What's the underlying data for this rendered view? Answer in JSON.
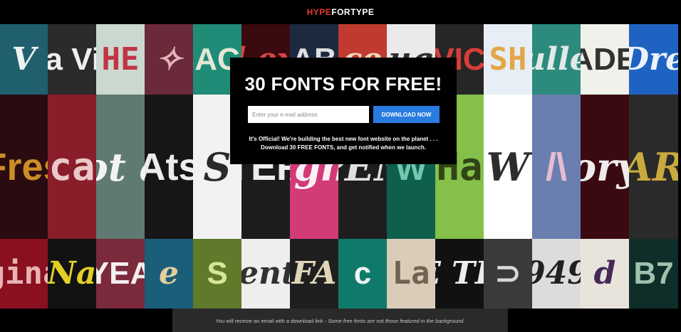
{
  "header": {
    "logo_hype": "HYPE",
    "logo_for_type": "FORTYPE"
  },
  "signup": {
    "title": "30 FONTS FOR FREE!",
    "email_placeholder": "Enter your e-mail address",
    "download_label": "DOWNLOAD NOW",
    "description_line1": "It's Official! We're building the best new font website on the planet . . .",
    "description_line2": "Download 30 FREE FONTS, and get notified when we launch."
  },
  "footer": {
    "text_normal": "You will receive an email with a download link - ",
    "text_italic": "Some free fonts are not those featured in the background."
  },
  "background_tiles": [
    {
      "text": "V",
      "bg": "#1f5f6e",
      "fg": "#ffffff"
    },
    {
      "text": "Sa Vin",
      "bg": "#2b2b2b",
      "fg": "#ffffff"
    },
    {
      "text": "HE",
      "bg": "#cbd8cf",
      "fg": "#c0283b"
    },
    {
      "text": "✧",
      "bg": "#6a2a3a",
      "fg": "#f0c0c8"
    },
    {
      "text": "BACC",
      "bg": "#1e8c76",
      "fg": "#f5efe0"
    },
    {
      "text": "al exq",
      "bg": "#3a0a0e",
      "fg": "#e54a4a"
    },
    {
      "text": "AB",
      "bg": "#1c2a40",
      "fg": "#f0f0f0"
    },
    {
      "text": "ce",
      "bg": "#c03a30",
      "fg": "#f7e7cc"
    },
    {
      "text": "ug",
      "bg": "#eaeaea",
      "fg": "#202020"
    },
    {
      "text": "VIC",
      "bg": "#262626",
      "fg": "#e8403a"
    },
    {
      "text": "SH",
      "bg": "#e8eef5",
      "fg": "#e3a13b"
    },
    {
      "text": "ulle",
      "bg": "#2c8b7d",
      "fg": "#f2f2f2"
    },
    {
      "text": "MADE T",
      "bg": "#f2f0ea",
      "fg": "#222222"
    },
    {
      "text": "Dre",
      "bg": "#1f63c2",
      "fg": "#ffffff"
    },
    {
      "text": "Fres",
      "bg": "#2a0c10",
      "fg": "#d99a2a"
    },
    {
      "text": "Scar",
      "bg": "#8a1d2a",
      "fg": "#f4d7d7"
    },
    {
      "text": "Not all",
      "bg": "#5f7a72",
      "fg": "#ffffff"
    },
    {
      "text": "Ats",
      "bg": "#161616",
      "fg": "#ffffff"
    },
    {
      "text": "S",
      "bg": "#f2f2f2",
      "fg": "#1a1a1a"
    },
    {
      "text": "TER",
      "bg": "#1c1c1c",
      "fg": "#ffffff"
    },
    {
      "text": "igh",
      "bg": "#d23a78",
      "fg": "#ffffff"
    },
    {
      "text": "PEN",
      "bg": "#1e1e1e",
      "fg": "#f0f0f0"
    },
    {
      "text": "w",
      "bg": "#0e5f4e",
      "fg": "#7ad1b8"
    },
    {
      "text": "Ha",
      "bg": "#84c04a",
      "fg": "#2a3a12"
    },
    {
      "text": "W",
      "bg": "#ffffff",
      "fg": "#1c1c1c"
    },
    {
      "text": "/\\",
      "bg": "#6a7fb0",
      "fg": "#f2c2d4"
    },
    {
      "text": "ory",
      "bg": "#3a0a10",
      "fg": "#ffffff"
    },
    {
      "text": "AR",
      "bg": "#2a2a2a",
      "fg": "#d7b540"
    },
    {
      "text": "gina",
      "bg": "#8a1020",
      "fg": "#f0c0c0"
    },
    {
      "text": "Na",
      "bg": "#121212",
      "fg": "#f4e12a"
    },
    {
      "text": "YEA",
      "bg": "#7a2a3a",
      "fg": "#ffffff"
    },
    {
      "text": "e",
      "bg": "#1a5e7a",
      "fg": "#f5d8a0"
    },
    {
      "text": "S",
      "bg": "#5f7a2a",
      "fg": "#e0f0a0"
    },
    {
      "text": "ssentia",
      "bg": "#eeeeee",
      "fg": "#222222"
    },
    {
      "text": "FA",
      "bg": "#1f1f1f",
      "fg": "#f0e6c8"
    },
    {
      "text": "c",
      "bg": "#0f7a6a",
      "fg": "#ffffff"
    },
    {
      "text": "La",
      "bg": "#d9ccb8",
      "fg": "#6a5a4a"
    },
    {
      "text": "BE THE",
      "bg": "#111111",
      "fg": "#ffffff"
    },
    {
      "text": "⊃",
      "bg": "#3a3a3a",
      "fg": "#e6e6e6"
    },
    {
      "text": "949",
      "bg": "#dcdcdc",
      "fg": "#111111"
    },
    {
      "text": "d",
      "bg": "#e8e4dc",
      "fg": "#3a1a4a"
    },
    {
      "text": "B7",
      "bg": "#0f2e2a",
      "fg": "#aad0b8"
    }
  ]
}
